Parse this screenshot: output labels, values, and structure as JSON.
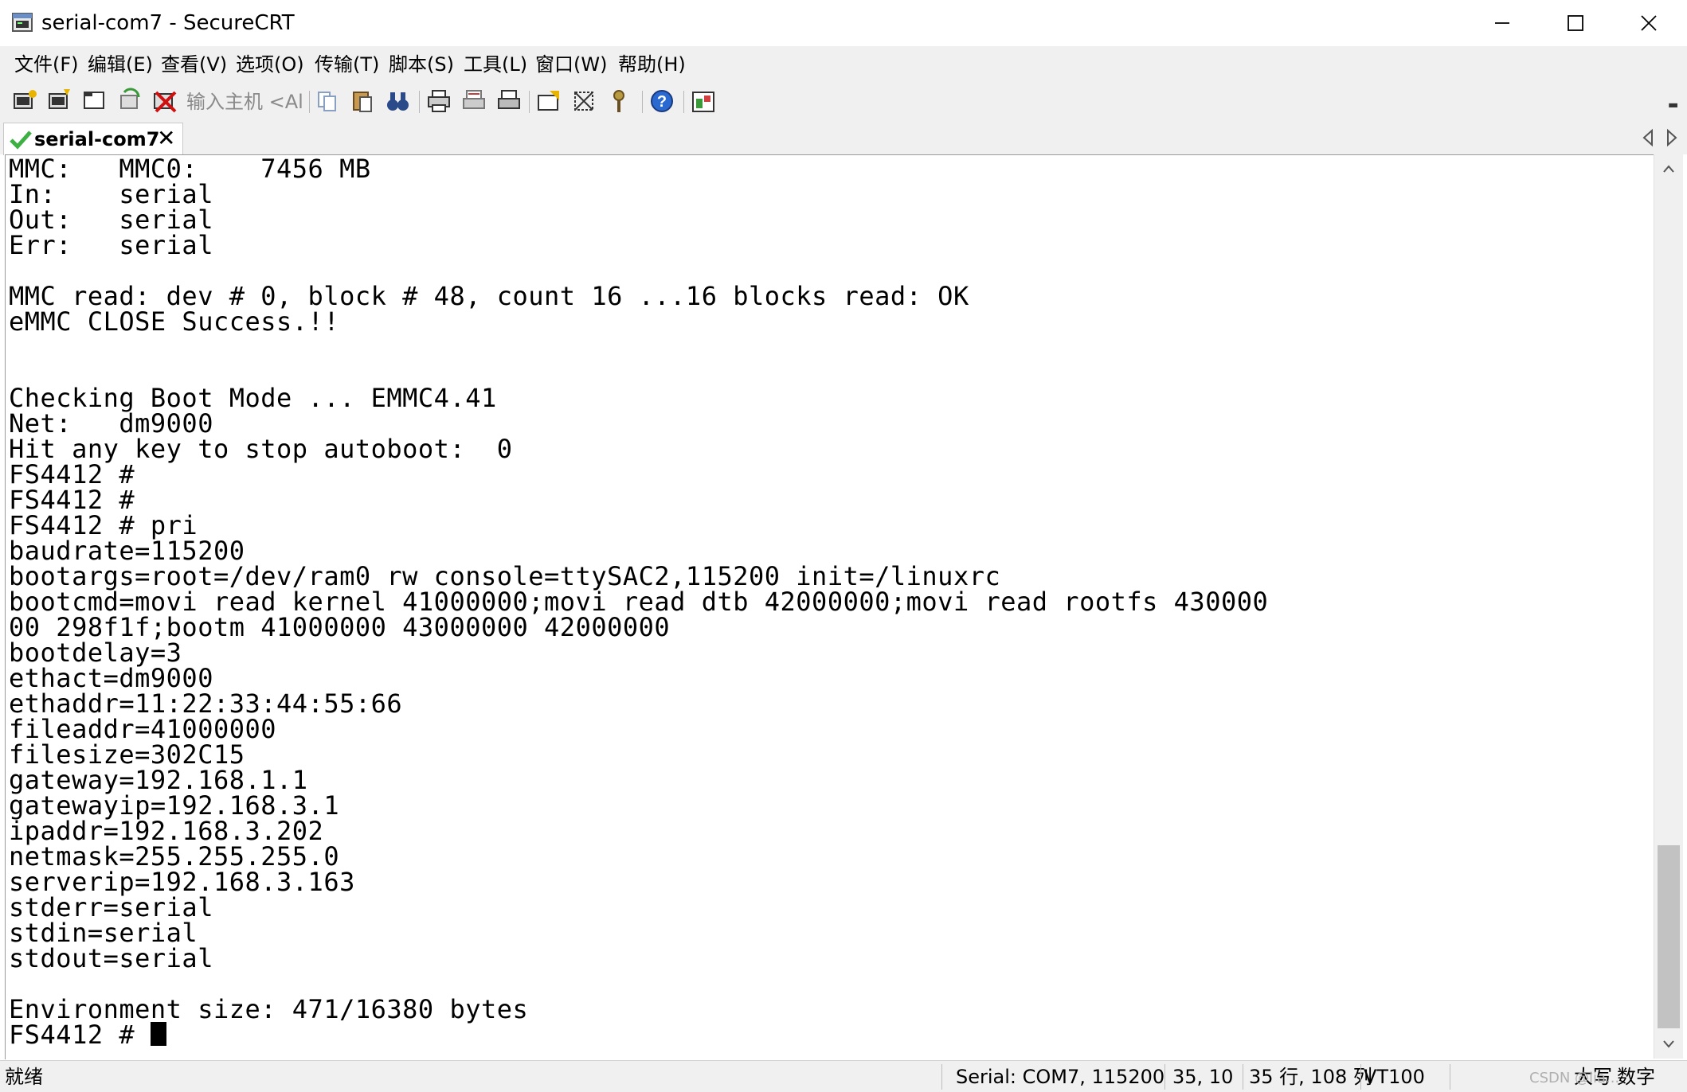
{
  "window": {
    "title": "serial-com7 - SecureCRT",
    "controls": [
      "minimize",
      "maximize",
      "close"
    ]
  },
  "menu": {
    "items": [
      "文件(F)",
      "编辑(E)",
      "查看(V)",
      "选项(O)",
      "传输(T)",
      "脚本(S)",
      "工具(L)",
      "窗口(W)",
      "帮助(H)"
    ]
  },
  "toolbar": {
    "quick_connect_placeholder": "输入主机 <Al",
    "icons": [
      "connect-icon",
      "quick-connect-icon",
      "connect-in-tab-icon",
      "reconnect-icon",
      "disconnect-icon",
      "copy-icon",
      "paste-icon",
      "find-icon",
      "print-setup-icon",
      "print-selection-icon",
      "print-icon",
      "session-options-icon",
      "global-options-icon",
      "keymap-icon",
      "help-icon",
      "sftp-icon"
    ]
  },
  "tab": {
    "label": "serial-com7",
    "close_symbol": "✕"
  },
  "terminal": {
    "lines": [
      "MMC:   MMC0:    7456 MB",
      "In:    serial",
      "Out:   serial",
      "Err:   serial",
      "",
      "MMC read: dev # 0, block # 48, count 16 ...16 blocks read: OK",
      "eMMC CLOSE Success.!!",
      "",
      "",
      "Checking Boot Mode ... EMMC4.41",
      "Net:   dm9000",
      "Hit any key to stop autoboot:  0",
      "FS4412 #",
      "FS4412 #",
      "FS4412 # pri",
      "baudrate=115200",
      "bootargs=root=/dev/ram0 rw console=ttySAC2,115200 init=/linuxrc",
      "bootcmd=movi read kernel 41000000;movi read dtb 42000000;movi read rootfs 430000",
      "00 298f1f;bootm 41000000 43000000 42000000",
      "bootdelay=3",
      "ethact=dm9000",
      "ethaddr=11:22:33:44:55:66",
      "fileaddr=41000000",
      "filesize=302C15",
      "gateway=192.168.1.1",
      "gatewayip=192.168.3.1",
      "ipaddr=192.168.3.202",
      "netmask=255.255.255.0",
      "serverip=192.168.3.163",
      "stderr=serial",
      "stdin=serial",
      "stdout=serial",
      "",
      "Environment size: 471/16380 bytes",
      "FS4412 # "
    ]
  },
  "status": {
    "ready": "就绪",
    "connection": "Serial: COM7, 115200",
    "cursor_pos": "35,  10",
    "dimensions": "35 行, 108 列",
    "emulation": "VT100",
    "caps": "大写",
    "num": "数字",
    "watermark": "CSDN @lia..."
  },
  "colors": {
    "chrome_bg": "#f0f0f0",
    "terminal_bg": "#ffffff",
    "terminal_fg": "#000000",
    "tab_check": "#3cb043"
  }
}
